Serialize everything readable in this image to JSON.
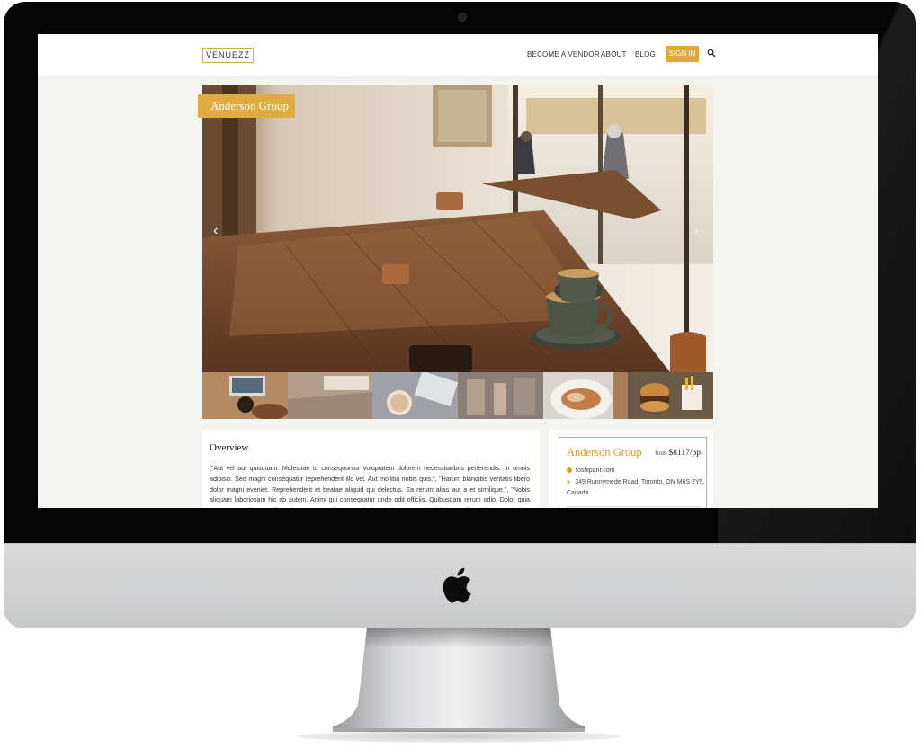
{
  "header": {
    "logo": "VENUEZZ",
    "nav": {
      "become_vendor": "BECOME A VENDOR",
      "about": "ABOUT",
      "blog": "BLOG",
      "sign_in": "SIGN IN"
    }
  },
  "hero": {
    "venue_tag": "Anderson Group",
    "prev_arrow": "‹",
    "next_arrow": "›",
    "thumbnail_count": 6
  },
  "overview": {
    "title": "Overview",
    "text": "[\"Aut vel aut quisquam. Molestiae ut consequuntur voluptatem dolorem necessitatibus perferendis. In omnis adipisci. Sed magni consequatur reprehenderit illo vel. Aut mollitia nobis quis.\", \"Harum blanditiis veritatis libero dolor magni eveniet. Reprehenderit et beatae aliquid qui delectus. Ea rerum alias aut a et similique.\", \"Nobis aliquam laboriosam hic ab autem. Animi qui consequatur unde odit officiis. Quibusdam rerum odio. Dolor quia sunt et asperiores nulla voluptatem.\", \"Odio ut molestiae voluptatum et incidunt repellat sed. Accusantium occaecati voluptatem distinctio unde."
  },
  "venue_card": {
    "name": "Anderson Group",
    "price_prefix": "from",
    "price": "$8117/pp",
    "website": "toshiparir.com",
    "address": "349 Runnymede Road, Toronto, ON M6S 2Y5, Canada"
  },
  "colors": {
    "accent": "#e0ac3f",
    "page_bg": "#f3f3ef",
    "bezel": "#050505"
  }
}
